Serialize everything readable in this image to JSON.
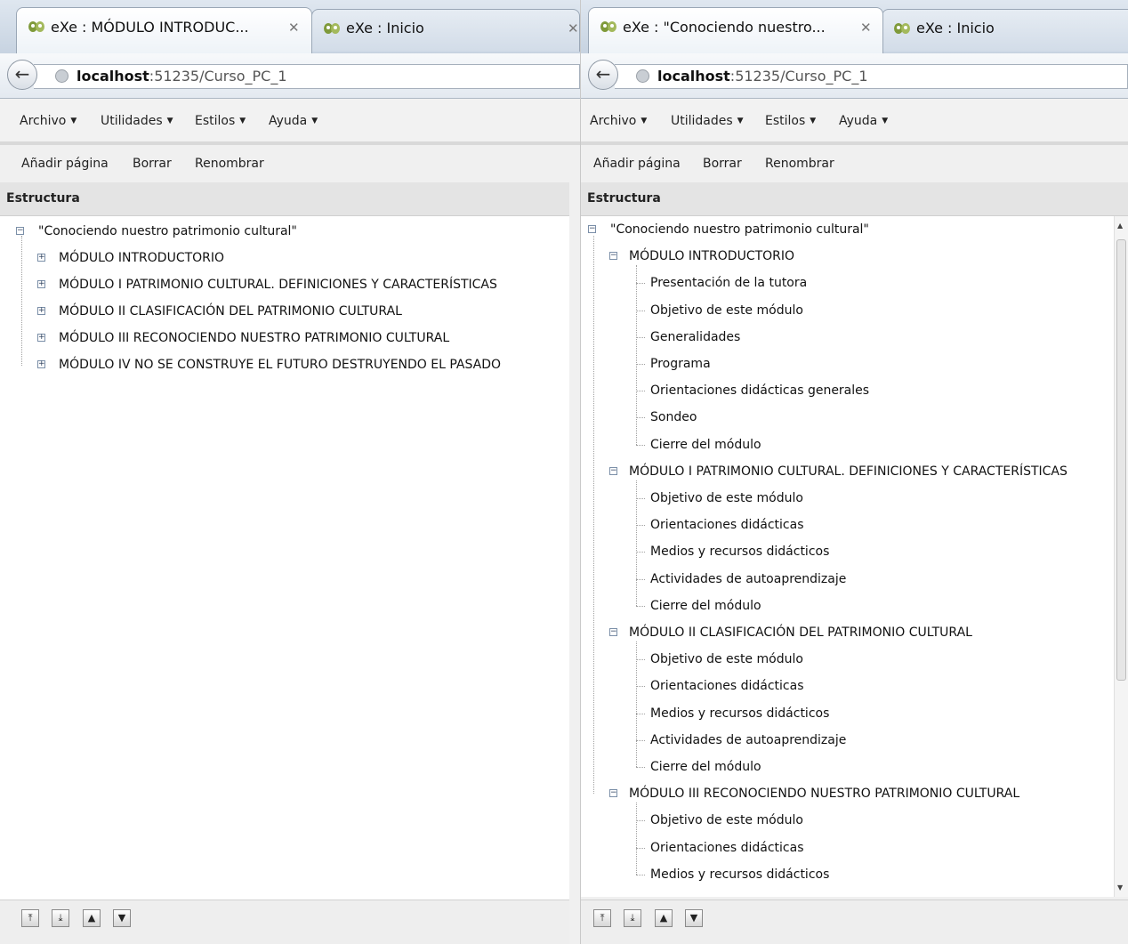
{
  "left": {
    "tabs": [
      {
        "title": "eXe : MÓDULO INTRODUC...",
        "close": "✕"
      },
      {
        "title": "eXe : Inicio",
        "close": "✕"
      }
    ],
    "url": {
      "host": "localhost",
      "rest": ":51235/Curso_PC_1"
    },
    "menu": [
      "Archivo",
      "Utilidades",
      "Estilos",
      "Ayuda"
    ],
    "actions": [
      "Añadir página",
      "Borrar",
      "Renombrar"
    ],
    "structure_label": "Estructura",
    "tree": {
      "root": "\"Conociendo nuestro patrimonio cultural\"",
      "modules": [
        "MÓDULO INTRODUCTORIO",
        "MÓDULO I PATRIMONIO CULTURAL. DEFINICIONES Y CARACTERÍSTICAS",
        "MÓDULO II CLASIFICACIÓN DEL PATRIMONIO CULTURAL",
        "MÓDULO III RECONOCIENDO NUESTRO PATRIMONIO CULTURAL",
        "MÓDULO IV NO SE CONSTRUYE EL FUTURO DESTRUYENDO EL PASADO"
      ]
    },
    "nav_buttons": [
      "move-top-icon",
      "move-bottom-icon",
      "move-up-icon",
      "move-down-icon"
    ]
  },
  "right": {
    "tabs": [
      {
        "title": "eXe : \"Conociendo nuestro...",
        "close": "✕"
      },
      {
        "title": "eXe : Inicio"
      }
    ],
    "url": {
      "host": "localhost",
      "rest": ":51235/Curso_PC_1"
    },
    "menu": [
      "Archivo",
      "Utilidades",
      "Estilos",
      "Ayuda"
    ],
    "actions": [
      "Añadir página",
      "Borrar",
      "Renombrar"
    ],
    "structure_label": "Estructura",
    "tree": {
      "root": "\"Conociendo nuestro patrimonio cultural\"",
      "modules": [
        {
          "title": "MÓDULO INTRODUCTORIO",
          "pages": [
            "Presentación de la tutora",
            "Objetivo de este módulo",
            "Generalidades",
            "Programa",
            "Orientaciones didácticas generales",
            "Sondeo",
            "Cierre del módulo"
          ]
        },
        {
          "title": "MÓDULO I PATRIMONIO CULTURAL. DEFINICIONES Y CARACTERÍSTICAS",
          "pages": [
            "Objetivo de este módulo",
            "Orientaciones didácticas",
            "Medios y recursos didácticos",
            "Actividades de autoaprendizaje",
            "Cierre del módulo"
          ]
        },
        {
          "title": "MÓDULO II CLASIFICACIÓN DEL PATRIMONIO CULTURAL",
          "pages": [
            "Objetivo de este módulo",
            "Orientaciones didácticas",
            "Medios y recursos didácticos",
            "Actividades de autoaprendizaje",
            "Cierre del módulo"
          ]
        },
        {
          "title": "MÓDULO III RECONOCIENDO NUESTRO PATRIMONIO CULTURAL",
          "pages": [
            "Objetivo de este módulo",
            "Orientaciones didácticas",
            "Medios y recursos didácticos"
          ]
        }
      ]
    },
    "nav_buttons": [
      "move-top-icon",
      "move-bottom-icon",
      "move-up-icon",
      "move-down-icon"
    ]
  },
  "colors": {
    "tree_line": "#a0a0a0",
    "expander_border": "#7b8fa8"
  }
}
